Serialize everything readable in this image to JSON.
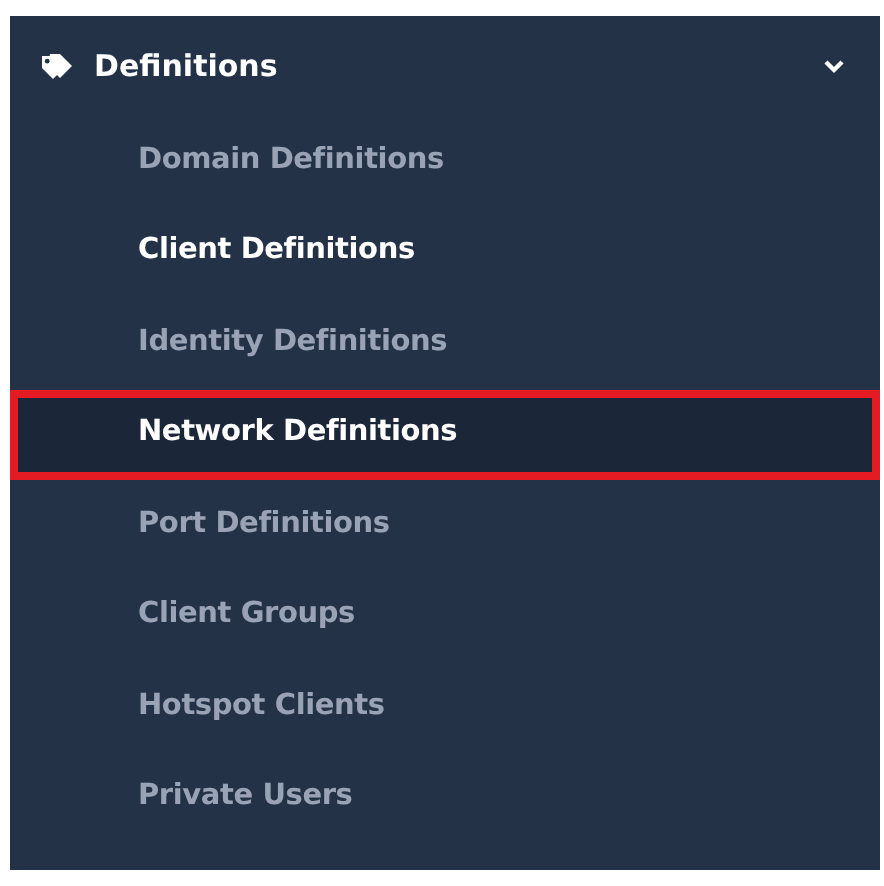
{
  "menu": {
    "title": "Definitions",
    "expanded": true,
    "items": [
      {
        "label": "Domain Definitions",
        "selected": false,
        "highlighted": false
      },
      {
        "label": "Client Definitions",
        "selected": true,
        "highlighted": false
      },
      {
        "label": "Identity Definitions",
        "selected": false,
        "highlighted": false
      },
      {
        "label": "Network Definitions",
        "selected": true,
        "highlighted": true
      },
      {
        "label": "Port Definitions",
        "selected": false,
        "highlighted": false
      },
      {
        "label": "Client Groups",
        "selected": false,
        "highlighted": false
      },
      {
        "label": "Hotspot Clients",
        "selected": false,
        "highlighted": false
      },
      {
        "label": "Private Users",
        "selected": false,
        "highlighted": false
      }
    ]
  }
}
